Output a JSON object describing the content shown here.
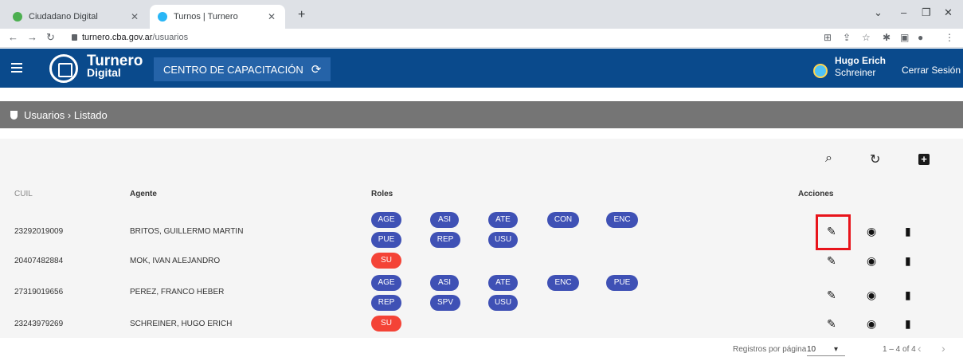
{
  "browser": {
    "tabs": [
      {
        "label": "Ciudadano Digital",
        "favicon_color": "#4caf50"
      },
      {
        "label": "Turnos | Turnero",
        "favicon_color": "#29b6f6"
      }
    ],
    "new_tab": "+",
    "url_host": "turnero.cba.gov.ar",
    "url_path": "/usuarios"
  },
  "app": {
    "logo_line1": "Turnero",
    "logo_line2": "Digital",
    "center_name": "CENTRO DE CAPACITACIÓN",
    "user_first": "Hugo Erich",
    "user_last": "Schreiner",
    "logout_label": "Cerrar Sesión"
  },
  "breadcrumb": "Usuarios › Listado",
  "table": {
    "headers": {
      "cuil": "CUIL",
      "agent": "Agente",
      "roles": "Roles",
      "actions": "Acciones"
    },
    "rows": [
      {
        "cuil": "23292019009",
        "agent": "BRITOS, GUILLERMO MARTIN",
        "roles": [
          "AGE",
          "ASI",
          "ATE",
          "CON",
          "ENC",
          "PUE",
          "REP",
          "USU"
        ]
      },
      {
        "cuil": "20407482884",
        "agent": "MOK, IVAN ALEJANDRO",
        "roles": [
          "SU"
        ]
      },
      {
        "cuil": "27319019656",
        "agent": "PEREZ, FRANCO HEBER",
        "roles": [
          "AGE",
          "ASI",
          "ATE",
          "ENC",
          "PUE",
          "REP",
          "SPV",
          "USU"
        ]
      },
      {
        "cuil": "23243979269",
        "agent": "SCHREINER, HUGO ERICH",
        "roles": [
          "SU"
        ]
      }
    ]
  },
  "colors": {
    "primary": "#0a4a8c",
    "chip": "#3f51b5",
    "chip_su": "#f44336",
    "highlight": "#e8141b"
  },
  "pagination": {
    "label": "Registros por página",
    "page_size": "10",
    "range": "1 – 4 of 4"
  }
}
